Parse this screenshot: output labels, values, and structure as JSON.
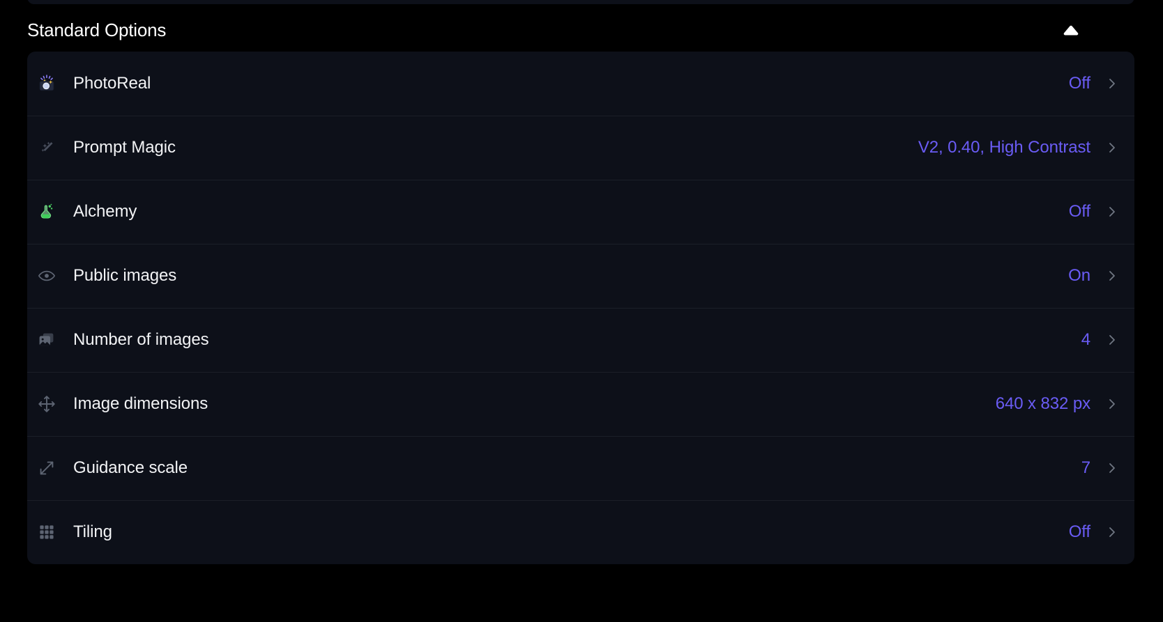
{
  "section": {
    "title": "Standard Options",
    "collapse_icon": "triangle-up-icon",
    "expanded": true
  },
  "theme": {
    "page_background": "#000000",
    "card_background": "#0d1019",
    "divider": "#1b1f28",
    "label_color": "#f2f3f5",
    "value_color": "#6a5cf5",
    "icon_color": "#5d6472",
    "chevron_color": "#6f7682"
  },
  "options": [
    {
      "label": "PhotoReal",
      "value": "Off",
      "icon": "camera-flash-icon",
      "chevron": "chevron-right-icon"
    },
    {
      "label": "Prompt Magic",
      "value": "V2, 0.40, High Contrast",
      "icon": "magic-wand-icon",
      "chevron": "chevron-right-icon"
    },
    {
      "label": "Alchemy",
      "value": "Off",
      "icon": "potion-flask-icon",
      "chevron": "chevron-right-icon"
    },
    {
      "label": "Public images",
      "value": "On",
      "icon": "eye-icon",
      "chevron": "chevron-right-icon"
    },
    {
      "label": "Number of images",
      "value": "4",
      "icon": "image-stack-icon",
      "chevron": "chevron-right-icon"
    },
    {
      "label": "Image dimensions",
      "value": "640 x 832 px",
      "icon": "move-arrows-icon",
      "chevron": "chevron-right-icon"
    },
    {
      "label": "Guidance scale",
      "value": "7",
      "icon": "diagonal-expand-icon",
      "chevron": "chevron-right-icon"
    },
    {
      "label": "Tiling",
      "value": "Off",
      "icon": "grid-3x3-icon",
      "chevron": "chevron-right-icon"
    }
  ]
}
